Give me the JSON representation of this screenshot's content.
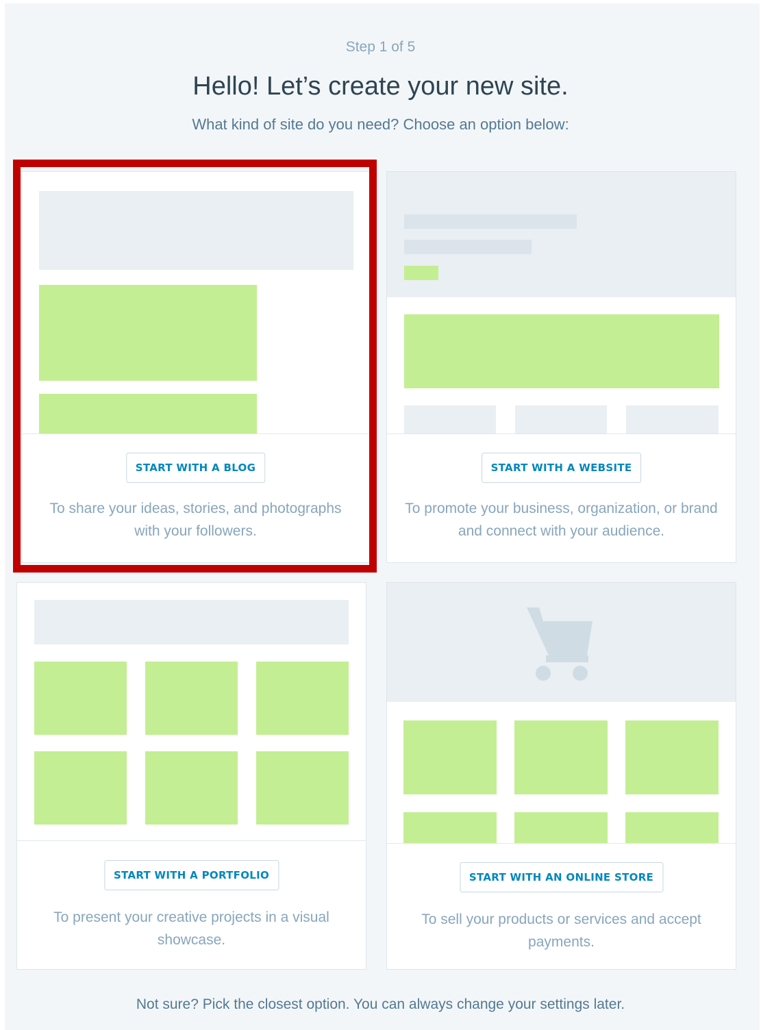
{
  "header": {
    "step": "Step 1 of 5",
    "title": "Hello! Let’s create your new site.",
    "subtitle": "What kind of site do you need? Choose an option below:"
  },
  "options": [
    {
      "button": "START WITH A BLOG",
      "description": "To share your ideas, stories, and photographs with your followers."
    },
    {
      "button": "START WITH A WEBSITE",
      "description": "To promote your business, organization, or brand and connect with your audience."
    },
    {
      "button": "START WITH A PORTFOLIO",
      "description": "To present your creative projects in a visual showcase."
    },
    {
      "button": "START WITH AN ONLINE STORE",
      "description": "To sell your products or services and accept payments.",
      "icon": "shopping-cart-icon"
    }
  ],
  "footer": {
    "note": "Not sure? Pick the closest option. You can always change your settings later."
  },
  "colors": {
    "accent": "#0087be",
    "placeholder_green": "#c4ee93",
    "placeholder_grey": "#e9eff3",
    "highlight": "#c00000"
  }
}
